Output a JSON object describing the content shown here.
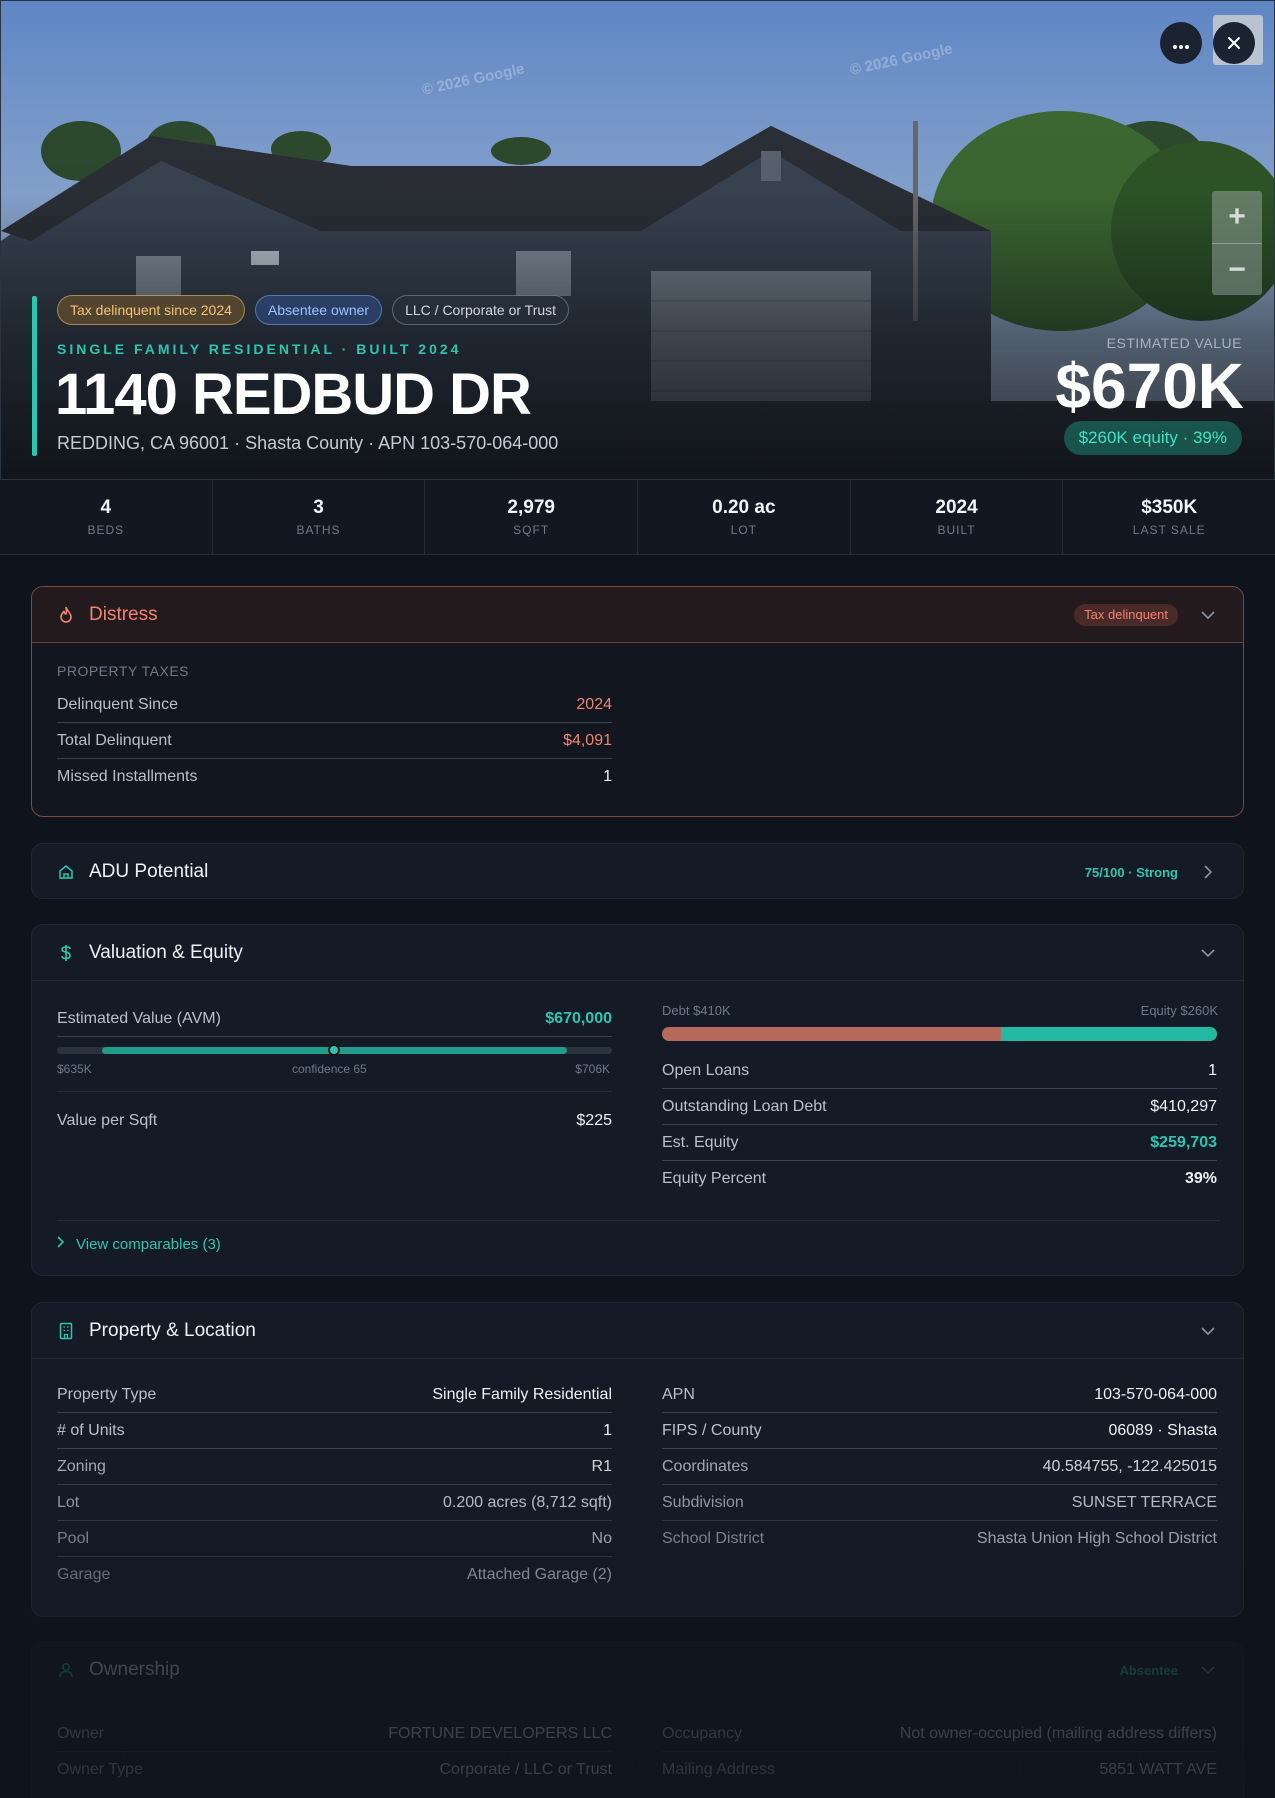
{
  "hero": {
    "watermark_1": "© 2026 Google",
    "watermark_2": "© 2026 Google",
    "badges": [
      "Tax delinquent since 2024",
      "Absentee owner",
      "LLC / Corporate or Trust"
    ],
    "subtype": "SINGLE FAMILY RESIDENTIAL · BUILT 2024",
    "address": "1140 REDBUD DR",
    "address_sub": "REDDING, CA 96001 · Shasta County · APN 103-570-064-000",
    "estimated_value_label": "ESTIMATED VALUE",
    "estimated_value": "$670K",
    "equity_pill": "$260K equity · 39%",
    "more_icon": "ellipsis-icon",
    "close_icon": "close-icon",
    "zoom_in": "+",
    "zoom_out": "−"
  },
  "stats": [
    {
      "value": "4",
      "label": "BEDS"
    },
    {
      "value": "3",
      "label": "BATHS"
    },
    {
      "value": "2,979",
      "label": "SQFT"
    },
    {
      "value": "0.20 ac",
      "label": "LOT"
    },
    {
      "value": "2024",
      "label": "BUILT"
    },
    {
      "value": "$350K",
      "label": "LAST SALE"
    }
  ],
  "distress": {
    "title": "Distress",
    "pill": "Tax delinquent",
    "section": "PROPERTY TAXES",
    "rows": [
      {
        "k": "Delinquent Since",
        "v": "2024"
      },
      {
        "k": "Total Delinquent",
        "v": "$4,091"
      },
      {
        "k": "Missed Installments",
        "v": "1"
      }
    ]
  },
  "adu": {
    "title": "ADU Potential",
    "score": "75/100 · Strong"
  },
  "valuation": {
    "title": "Valuation & Equity",
    "avm_label": "Estimated Value (AVM)",
    "avm_value": "$670,000",
    "range_low": "$635K",
    "range_high": "$706K",
    "confidence": "confidence 65",
    "vps_label": "Value per Sqft",
    "vps_value": "$225",
    "debt_label": "Debt $410K",
    "equity_label": "Equity $260K",
    "debt_fraction": 0.61,
    "rows": [
      {
        "k": "Open Loans",
        "v": "1"
      },
      {
        "k": "Outstanding Loan Debt",
        "v": "$410,297"
      },
      {
        "k": "Est. Equity",
        "v": "$259,703"
      },
      {
        "k": "Equity Percent",
        "v": "39%"
      }
    ],
    "comparables": "View comparables (3)"
  },
  "property": {
    "title": "Property & Location",
    "left": [
      {
        "k": "Property Type",
        "v": "Single Family Residential"
      },
      {
        "k": "# of Units",
        "v": "1"
      },
      {
        "k": "Zoning",
        "v": "R1"
      },
      {
        "k": "Lot",
        "v": "0.200 acres (8,712 sqft)"
      },
      {
        "k": "Pool",
        "v": "No"
      },
      {
        "k": "Garage",
        "v": "Attached Garage (2)"
      }
    ],
    "right": [
      {
        "k": "APN",
        "v": "103-570-064-000"
      },
      {
        "k": "FIPS / County",
        "v": "06089 · Shasta"
      },
      {
        "k": "Coordinates",
        "v": "40.584755, -122.425015"
      },
      {
        "k": "Subdivision",
        "v": "SUNSET TERRACE"
      },
      {
        "k": "School District",
        "v": "Shasta Union High School District"
      }
    ]
  },
  "ownership": {
    "title": "Ownership",
    "pill": "Absentee",
    "left": [
      {
        "k": "Owner",
        "v": "FORTUNE DEVELOPERS LLC"
      },
      {
        "k": "Owner Type",
        "v": "Corporate / LLC or Trust"
      }
    ],
    "right": [
      {
        "k": "Occupancy",
        "v": "Not owner-occupied (mailing address differs)"
      },
      {
        "k": "Mailing Address",
        "v": "5851 WATT AVE"
      }
    ]
  },
  "colors": {
    "accent": "#2cc6b0",
    "danger": "#f08470",
    "debt": "#b76a5c",
    "background": "#0f141c"
  }
}
